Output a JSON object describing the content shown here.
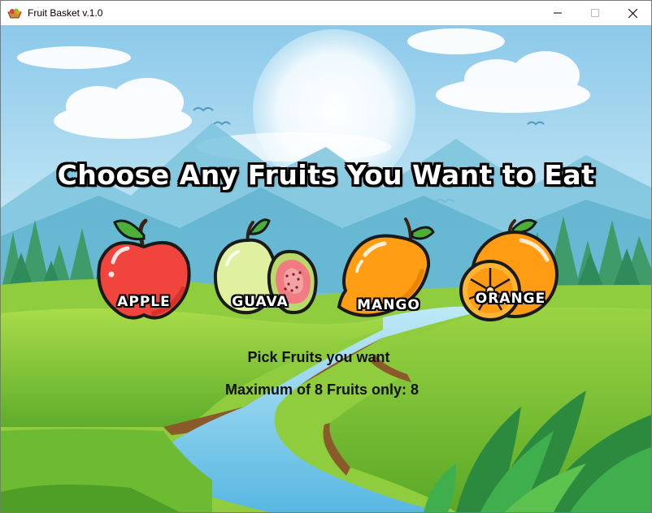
{
  "window": {
    "title": "Fruit Basket v.1.0",
    "controls": [
      "minimize",
      "maximize",
      "close"
    ]
  },
  "headline": "Choose Any Fruits You Want to Eat",
  "fruits": [
    {
      "label": "APPLE",
      "icon": "apple-icon"
    },
    {
      "label": "GUAVA",
      "icon": "guava-icon"
    },
    {
      "label": "MANGO",
      "icon": "mango-icon"
    },
    {
      "label": "ORANGE",
      "icon": "orange-icon"
    }
  ],
  "instructions": {
    "pick_text": "Pick Fruits you want",
    "max_text": "Maximum of 8 Fruits only: 8"
  },
  "colors": {
    "sky": "#9fd3ee",
    "grass": "#79c23a",
    "river": "#6fc3e6",
    "apple": "#f0443c",
    "guava": "#dff0a0",
    "mango": "#ff9d14",
    "orange": "#ff8f0e"
  }
}
